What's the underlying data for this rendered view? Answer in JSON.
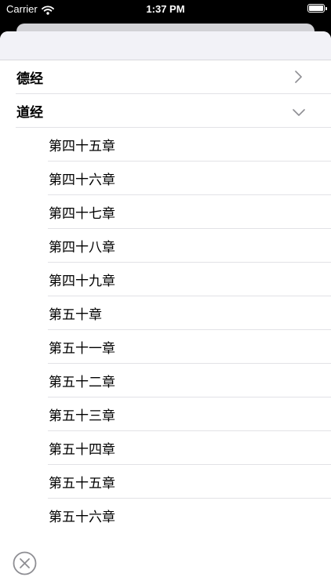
{
  "status_bar": {
    "carrier": "Carrier",
    "time": "1:37 PM"
  },
  "sections": [
    {
      "label": "德经",
      "expanded": false
    },
    {
      "label": "道经",
      "expanded": true
    }
  ],
  "chapters": [
    "第四十五章",
    "第四十六章",
    "第四十七章",
    "第四十八章",
    "第四十九章",
    "第五十章",
    "第五十一章",
    "第五十二章",
    "第五十三章",
    "第五十四章",
    "第五十五章",
    "第五十六章"
  ],
  "icons": {
    "wifi": "wifi-icon",
    "battery": "battery-icon",
    "chevron_right": "chevron-right-icon",
    "chevron_down": "chevron-down-icon",
    "close": "close-circle-icon"
  },
  "colors": {
    "chevron": "#8e8e93",
    "separator": "#e2e2e6",
    "close": "#8e8e93"
  }
}
